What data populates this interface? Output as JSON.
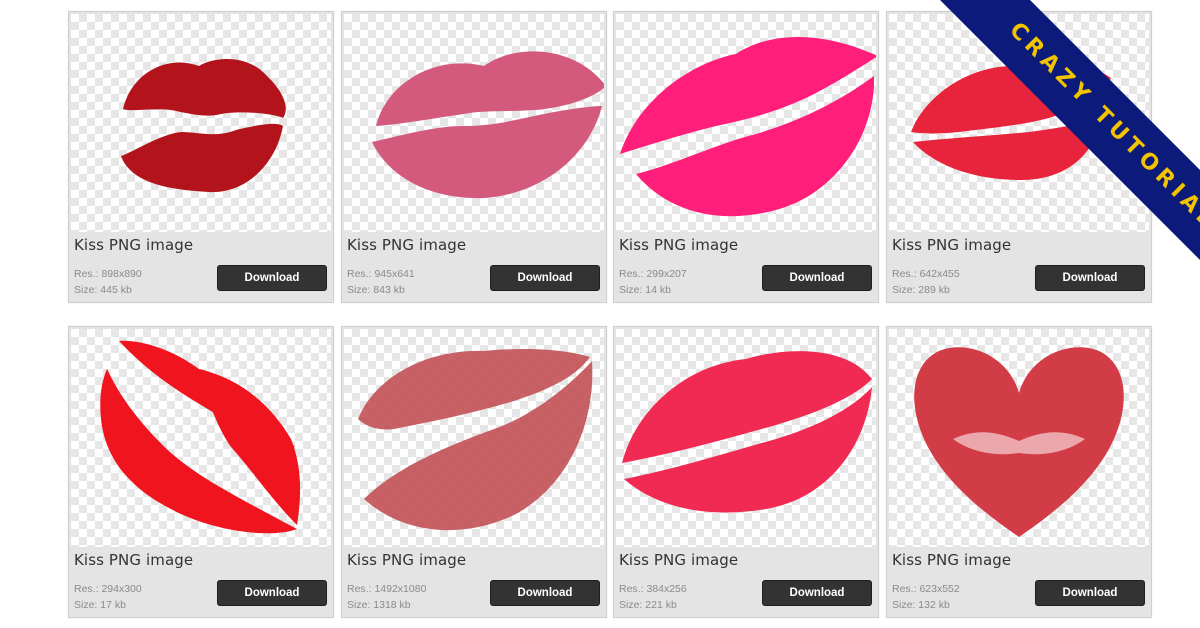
{
  "banner": {
    "text": "CRAZY TUTORIAL",
    "bg_color": "#0c1a7a",
    "text_color": "#f2c400"
  },
  "labels": {
    "res_prefix": "Res.:",
    "size_prefix": "Size:"
  },
  "cards": [
    {
      "title": "Kiss PNG image",
      "res": "898x890",
      "size": "445 kb",
      "download_label": "Download",
      "lip_color": "#b3141c"
    },
    {
      "title": "Kiss PNG image",
      "res": "945x641",
      "size": "843 kb",
      "download_label": "Download",
      "lip_color": "#d35a7d"
    },
    {
      "title": "Kiss PNG image",
      "res": "299x207",
      "size": "14 kb",
      "download_label": "Download",
      "lip_color": "#ff1f7a"
    },
    {
      "title": "Kiss PNG image",
      "res": "642x455",
      "size": "289 kb",
      "download_label": "Download",
      "lip_color": "#e8243c"
    },
    {
      "title": "Kiss PNG image",
      "res": "294x300",
      "size": "17 kb",
      "download_label": "Download",
      "lip_color": "#f0141e"
    },
    {
      "title": "Kiss PNG image",
      "res": "1492x1080",
      "size": "1318 kb",
      "download_label": "Download",
      "lip_color": "#c0464c"
    },
    {
      "title": "Kiss PNG image",
      "res": "384x256",
      "size": "221 kb",
      "download_label": "Download",
      "lip_color": "#f02a52"
    },
    {
      "title": "Kiss PNG image",
      "res": "623x552",
      "size": "132 kb",
      "download_label": "Download",
      "lip_color": "#d23c46"
    }
  ]
}
